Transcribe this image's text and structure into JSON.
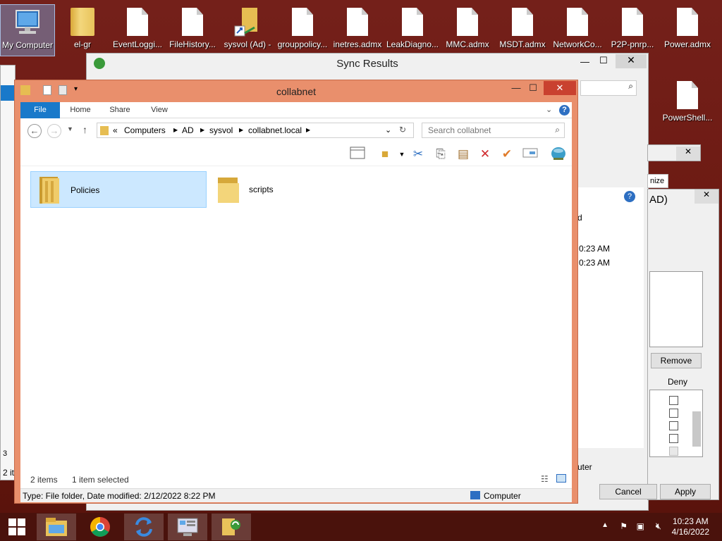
{
  "desktop": {
    "icons": [
      {
        "label": "My Computer",
        "type": "computer"
      },
      {
        "label": "el-gr",
        "type": "folder"
      },
      {
        "label": "EventLoggi...",
        "type": "doc"
      },
      {
        "label": "FileHistory...",
        "type": "doc"
      },
      {
        "label": "sysvol (Ad) -",
        "type": "shortcut"
      },
      {
        "label": "grouppolicy...",
        "type": "doc"
      },
      {
        "label": "inetres.admx",
        "type": "doc"
      },
      {
        "label": "LeakDiagno...",
        "type": "doc"
      },
      {
        "label": "MMC.admx",
        "type": "doc"
      },
      {
        "label": "MSDT.admx",
        "type": "doc"
      },
      {
        "label": "NetworkCo...",
        "type": "doc"
      },
      {
        "label": "P2P-pnrp...",
        "type": "doc"
      },
      {
        "label": "Power.admx",
        "type": "doc"
      },
      {
        "label": "PowerShell...",
        "type": "doc"
      }
    ]
  },
  "sync_results": {
    "title": "Sync Results"
  },
  "background_dialog": {
    "title_fragment": "AD)",
    "col_fragment": "d",
    "time1": "0:23 AM",
    "time2": "0:23 AM",
    "remove_label": "Remove",
    "deny_label": "Deny",
    "customize_fragment": "nize",
    "computer_fragment": "uter",
    "cancel_label": "Cancel",
    "apply_label": "Apply"
  },
  "left_fragment": {
    "status1": "3",
    "status2": "2 it"
  },
  "explorer": {
    "title": "collabnet",
    "tabs": [
      "File",
      "Home",
      "Share",
      "View"
    ],
    "address": {
      "prefix": "«",
      "crumbs": [
        "Computers",
        "AD",
        "sysvol",
        "collabnet.local"
      ]
    },
    "search_placeholder": "Search collabnet",
    "items": [
      {
        "name": "Policies",
        "selected": true
      },
      {
        "name": "scripts",
        "selected": false
      }
    ],
    "status": {
      "count": "2 items",
      "selected": "1 item selected"
    },
    "details": {
      "text": "Type: File folder, Date modified: 2/12/2022 8:22 PM",
      "location": "Computer"
    }
  },
  "taskbar": {
    "clock_time": "10:23 AM",
    "clock_date": "4/16/2022"
  },
  "colors": {
    "window_frame": "#e98f6c",
    "file_tab": "#1979ca",
    "selection": "#cce8ff",
    "desktop": "#6f1c14"
  }
}
